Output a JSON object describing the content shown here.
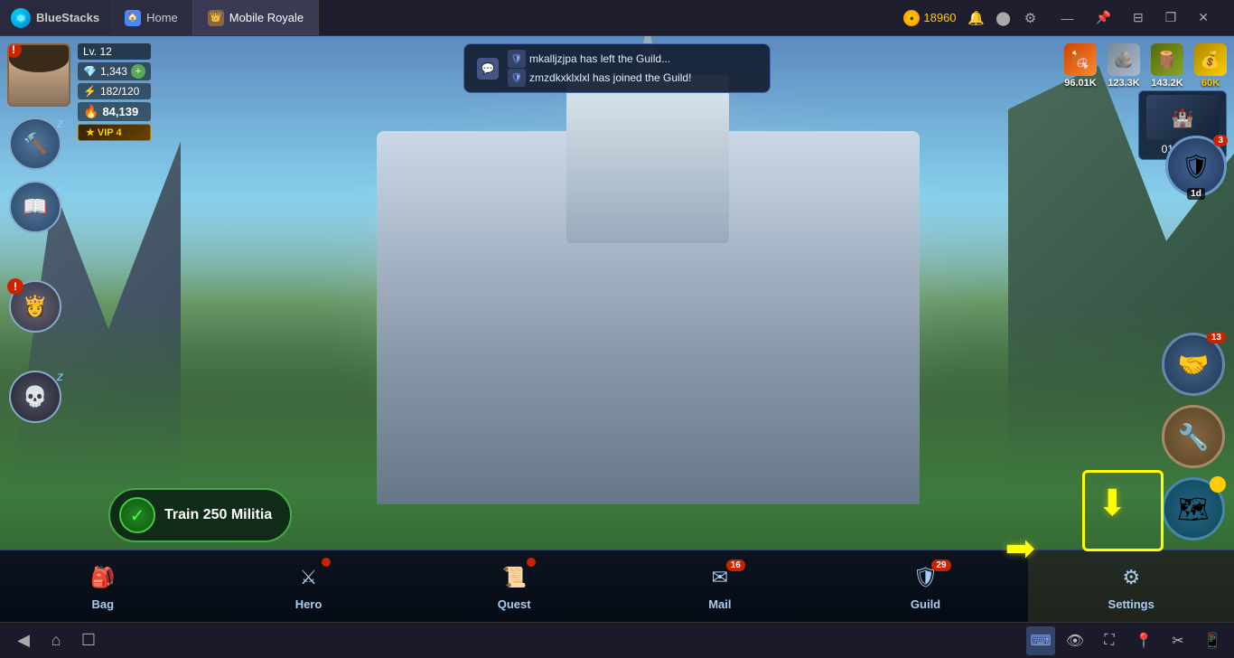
{
  "titlebar": {
    "app_name": "BlueStacks",
    "tabs": [
      {
        "id": "home",
        "label": "Home",
        "active": false
      },
      {
        "id": "mobile-royale",
        "label": "Mobile Royale",
        "active": true
      }
    ],
    "coins": "18960",
    "window_controls": {
      "minimize": "—",
      "restore": "❐",
      "close": "✕",
      "pin": "📌",
      "shrink": "⊟"
    }
  },
  "player": {
    "level": "Lv. 12",
    "diamonds": "1,343",
    "energy": "182/120",
    "power": "84,139",
    "vip": "VIP 4",
    "exclamation": "!"
  },
  "resources": {
    "food": {
      "value": "96.01K",
      "icon": "🍖"
    },
    "stone": {
      "value": "123.3K",
      "icon": "🪨"
    },
    "wood": {
      "value": "143.2K",
      "icon": "🪵"
    },
    "gold": {
      "value": "60K",
      "icon": "💰"
    }
  },
  "chat_notification": {
    "line1": "mkalljzjpa has left the Guild...",
    "line2": "zmzdkxklxlxl has joined the Guild!"
  },
  "sidebar_buttons": [
    {
      "id": "hammer",
      "icon": "🔨",
      "sleeping": true
    },
    {
      "id": "book",
      "icon": "📖",
      "sleeping": true
    },
    {
      "id": "skull",
      "icon": "💀",
      "sleeping": true
    }
  ],
  "timer": {
    "value": "01:55:18"
  },
  "event_badge": {
    "count": "3",
    "duration": "1d",
    "icon": "🛡"
  },
  "quest": {
    "label": "Train 250 Militia"
  },
  "bottom_nav": [
    {
      "id": "bag",
      "label": "Bag",
      "icon": "🎒",
      "badge": null
    },
    {
      "id": "hero",
      "label": "Hero",
      "icon": "⚔",
      "badge": "!",
      "has_dot": true
    },
    {
      "id": "quest",
      "label": "Quest",
      "icon": "📜",
      "badge": "!",
      "has_dot": true
    },
    {
      "id": "mail",
      "label": "Mail",
      "icon": "✉",
      "badge": "16"
    },
    {
      "id": "guild",
      "label": "Guild",
      "icon": "🛡",
      "badge": "29"
    },
    {
      "id": "settings",
      "label": "Settings",
      "icon": "⚙",
      "badge": null,
      "highlighted": true
    }
  ],
  "right_buttons": [
    {
      "id": "alliance",
      "icon": "🤝",
      "badge": "13"
    },
    {
      "id": "tools",
      "icon": "🔧",
      "badge": null
    },
    {
      "id": "map",
      "icon": "🗺",
      "badge": null,
      "lightning": true
    }
  ],
  "taskbar": {
    "left_icons": [
      "◀",
      "🏠"
    ],
    "right_icons": [
      {
        "id": "keyboard",
        "icon": "⌨",
        "active": true
      },
      {
        "id": "eye",
        "icon": "👁",
        "active": false
      },
      {
        "id": "expand",
        "icon": "⛶",
        "active": false
      },
      {
        "id": "location",
        "icon": "📍",
        "active": false
      },
      {
        "id": "scissors",
        "icon": "✂",
        "active": false
      },
      {
        "id": "phone",
        "icon": "📱",
        "active": false
      }
    ]
  },
  "arrow": {
    "color": "#ffff00"
  }
}
